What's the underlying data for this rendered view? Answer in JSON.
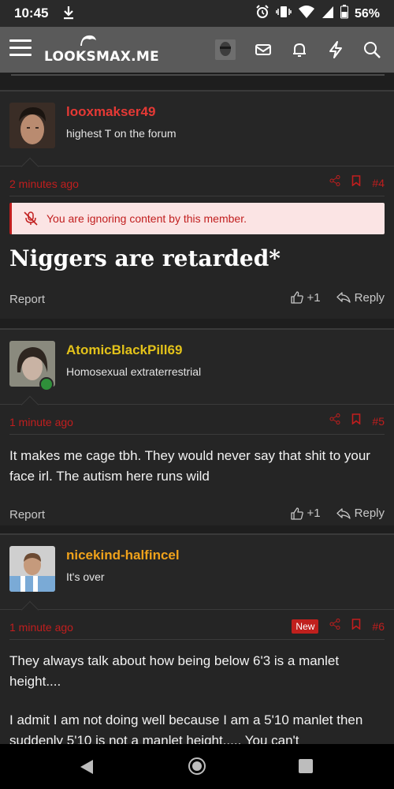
{
  "status_bar": {
    "time": "10:45",
    "battery": "56%"
  },
  "app_bar": {
    "logo_text": "LOOKSMAX.ME"
  },
  "colors": {
    "accent_red": "#c11e1e",
    "username_red": "#e53935",
    "username_gold": "#e3c21a",
    "username_orange": "#f0a21b"
  },
  "posts": [
    {
      "username": "looxmakser49",
      "user_title": "highest T on the forum",
      "time": "2 minutes ago",
      "number": "#4",
      "is_new": false,
      "ignore_notice": "You are ignoring content by this member.",
      "body": "Niggers are retarded*",
      "report_label": "Report",
      "like_count": "+1",
      "reply_label": "Reply"
    },
    {
      "username": "AtomicBlackPill69",
      "user_title": "Homosexual extraterrestrial",
      "time": "1 minute ago",
      "number": "#5",
      "is_new": false,
      "body": "It makes me cage tbh. They would never say that shit to your face irl. The autism here runs wild",
      "report_label": "Report",
      "like_count": "+1",
      "reply_label": "Reply"
    },
    {
      "username": "nicekind-halfincel",
      "user_title": "It's over",
      "time": "1 minute ago",
      "number": "#6",
      "is_new": true,
      "new_label": "New",
      "body_p1": "They always talk about how being below 6'3 is a manlet height....",
      "body_p2": "I admit I am not doing well because I am a 5'10 manlet then suddenly 5'10 is not a manlet height..... You can't"
    }
  ]
}
